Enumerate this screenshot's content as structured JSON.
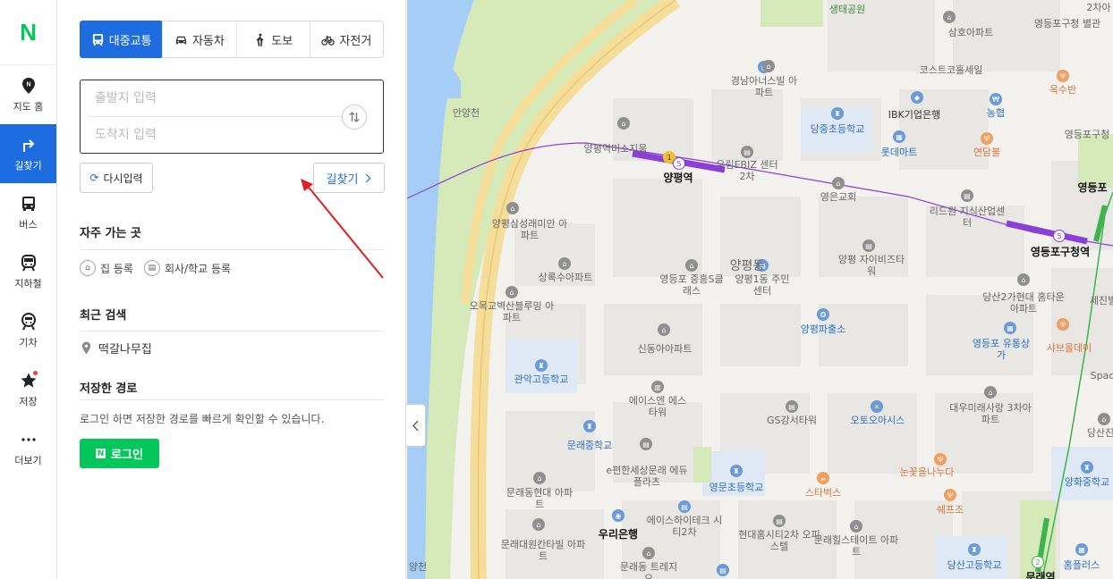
{
  "rail": {
    "logo": "N",
    "items": [
      {
        "label": "지도 홈",
        "icon": "map-pin-icon"
      },
      {
        "label": "길찾기",
        "icon": "directions-icon"
      },
      {
        "label": "버스",
        "icon": "bus-icon"
      },
      {
        "label": "지하철",
        "icon": "subway-icon"
      },
      {
        "label": "기차",
        "icon": "train-icon"
      },
      {
        "label": "저장",
        "icon": "star-icon"
      },
      {
        "label": "더보기",
        "icon": "more-icon"
      }
    ]
  },
  "modes": [
    {
      "label": "대중교통",
      "icon": "bus-icon"
    },
    {
      "label": "자동차",
      "icon": "car-icon"
    },
    {
      "label": "도보",
      "icon": "walk-icon"
    },
    {
      "label": "자전거",
      "icon": "bicycle-icon"
    }
  ],
  "route": {
    "origin_placeholder": "출발지 입력",
    "dest_placeholder": "도착지 입력",
    "reset_label": "다시입력",
    "find_label": "길찾기"
  },
  "frequent": {
    "title": "자주 가는 곳",
    "home": "집 등록",
    "work": "회사/학교 등록"
  },
  "recent": {
    "title": "최근 검색",
    "item": "떡갈나무집"
  },
  "saved": {
    "title": "저장한 경로",
    "note": "로그인 하면 저장한 경로를 빠르게 확인할 수 있습니다.",
    "login_label": "로그인",
    "login_badge": "N"
  },
  "colors": {
    "accent": "#1d6de0",
    "naver_green": "#03c75a",
    "line5": "#8a3fd6",
    "line2": "#3cb44b",
    "annotation_arrow": "#e02020"
  },
  "map": {
    "labels": {
      "ecopark": "생태공원",
      "samho": "삼호아파트",
      "ydp_office": "영등포구청 별관",
      "costco": "코스트코홀세일",
      "oksu": "옥수반",
      "gyeongnam": "경남아너스빌 아파트",
      "ibk": "IBK기업은행",
      "nonghyup": "농협",
      "anyangcheon": "안양천",
      "dangjung_school": "당중초등학교",
      "lotte": "롯데마트",
      "yeondam": "연담불",
      "ydp_gucheong": "영등포구청",
      "yangpyeong_misojigum": "양평역미소지움",
      "urim": "우림EBIZ 센터2차",
      "yangpyeong_stn": "양평역",
      "yeongeun": "영은교회",
      "lidwon": "리드원 지식산업센터",
      "ydp_stn": "영등포구청역",
      "ydp_stn_top": "영등포",
      "samseong": "양평삼성래미안 아파트",
      "yangpyeong_jai": "양평 자이비즈타워",
      "yangpyeongdong": "양평동",
      "sangrok": "상록수아파트",
      "ydp_jungheung": "영등포 중흥S클래스",
      "center1": "양평1동 주민센터",
      "dangsan2": "당산2가현대 홈타운아파트",
      "sejin": "세진빌",
      "omok": "오목교벽산블루밍 아파트",
      "yangpyeong_police": "양평파출소",
      "sindong": "신동아아파트",
      "ydp_mall": "영등포 유통상가",
      "sabuldei": "샤브올데이",
      "gwanak": "관악고등학교",
      "sns": "에이스엔 에스타워",
      "gs": "GS강서타워",
      "autooasis": "오토오아시스",
      "daewoo": "대우미래사랑 3차아파트",
      "space": "Spac",
      "munrae_middle": "문래중학교",
      "ebook": "e편한세상문래 에듀플라츠",
      "nunkkot": "눈꽃을나누다",
      "dangsanjin": "당산진",
      "munrae_hyundai": "문래동현대 아파트",
      "yeongmun": "영문초등학교",
      "starbucks": "스타벅스",
      "chefs": "쉐프조",
      "yanghwa": "양화중학교",
      "woori": "우리은행",
      "ace_tech": "에이스하이테크 시티2차",
      "hyundai_hills": "현대홈시티2차 오피스텔",
      "munrae_hills": "문래힐스테이트 아파트",
      "munrae_daewon": "문래대원칸타빌 아파트",
      "munraedong": "문래동 트레지오",
      "dangsan_high": "당산고등학교",
      "homeplus": "홈플러스",
      "munrae_stn": "문래역",
      "yangcheon": "양천",
      "two_top": "2차아"
    }
  }
}
